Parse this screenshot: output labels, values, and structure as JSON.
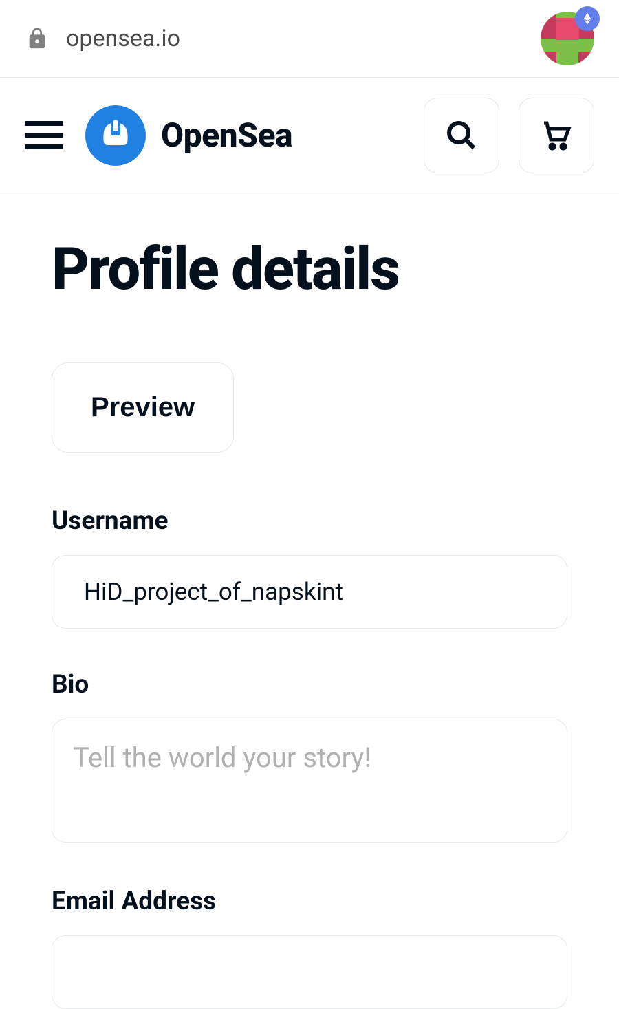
{
  "browser": {
    "url": "opensea.io"
  },
  "header": {
    "brand": "OpenSea"
  },
  "page": {
    "title": "Profile details",
    "preview_button": "Preview"
  },
  "form": {
    "username": {
      "label": "Username",
      "value": "HiD_project_of_napskint"
    },
    "bio": {
      "label": "Bio",
      "placeholder": "Tell the world your story!",
      "value": ""
    },
    "email": {
      "label": "Email Address",
      "value": ""
    }
  }
}
